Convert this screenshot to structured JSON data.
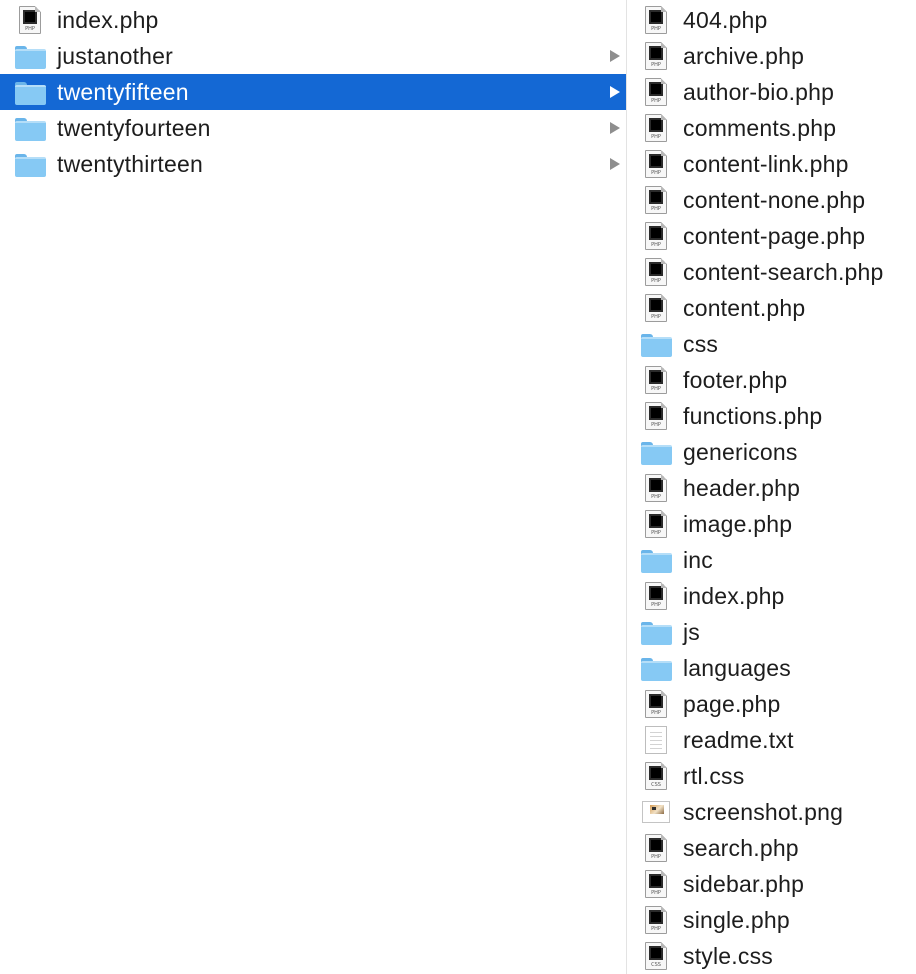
{
  "left_column": {
    "items": [
      {
        "name": "index.php",
        "kind": "php-file",
        "icon_tag": "PHP",
        "has_arrow": false,
        "selected": false
      },
      {
        "name": "justanother",
        "kind": "folder",
        "has_arrow": true,
        "selected": false
      },
      {
        "name": "twentyfifteen",
        "kind": "folder",
        "has_arrow": true,
        "selected": true
      },
      {
        "name": "twentyfourteen",
        "kind": "folder",
        "has_arrow": true,
        "selected": false
      },
      {
        "name": "twentythirteen",
        "kind": "folder",
        "has_arrow": true,
        "selected": false
      }
    ]
  },
  "right_column": {
    "items": [
      {
        "name": "404.php",
        "kind": "php-file",
        "icon_tag": "PHP"
      },
      {
        "name": "archive.php",
        "kind": "php-file",
        "icon_tag": "PHP"
      },
      {
        "name": "author-bio.php",
        "kind": "php-file",
        "icon_tag": "PHP"
      },
      {
        "name": "comments.php",
        "kind": "php-file",
        "icon_tag": "PHP"
      },
      {
        "name": "content-link.php",
        "kind": "php-file",
        "icon_tag": "PHP"
      },
      {
        "name": "content-none.php",
        "kind": "php-file",
        "icon_tag": "PHP"
      },
      {
        "name": "content-page.php",
        "kind": "php-file",
        "icon_tag": "PHP"
      },
      {
        "name": "content-search.php",
        "kind": "php-file",
        "icon_tag": "PHP"
      },
      {
        "name": "content.php",
        "kind": "php-file",
        "icon_tag": "PHP"
      },
      {
        "name": "css",
        "kind": "folder"
      },
      {
        "name": "footer.php",
        "kind": "php-file",
        "icon_tag": "PHP"
      },
      {
        "name": "functions.php",
        "kind": "php-file",
        "icon_tag": "PHP"
      },
      {
        "name": "genericons",
        "kind": "folder"
      },
      {
        "name": "header.php",
        "kind": "php-file",
        "icon_tag": "PHP"
      },
      {
        "name": "image.php",
        "kind": "php-file",
        "icon_tag": "PHP"
      },
      {
        "name": "inc",
        "kind": "folder"
      },
      {
        "name": "index.php",
        "kind": "php-file",
        "icon_tag": "PHP"
      },
      {
        "name": "js",
        "kind": "folder"
      },
      {
        "name": "languages",
        "kind": "folder"
      },
      {
        "name": "page.php",
        "kind": "php-file",
        "icon_tag": "PHP"
      },
      {
        "name": "readme.txt",
        "kind": "text-file"
      },
      {
        "name": "rtl.css",
        "kind": "css-file",
        "icon_tag": "CSS"
      },
      {
        "name": "screenshot.png",
        "kind": "image-file"
      },
      {
        "name": "search.php",
        "kind": "php-file",
        "icon_tag": "PHP"
      },
      {
        "name": "sidebar.php",
        "kind": "php-file",
        "icon_tag": "PHP"
      },
      {
        "name": "single.php",
        "kind": "php-file",
        "icon_tag": "PHP"
      },
      {
        "name": "style.css",
        "kind": "css-file",
        "icon_tag": "CSS"
      }
    ]
  },
  "colors": {
    "selection": "#1468d4",
    "folder": "#86c9f4",
    "arrow": "#8e8e8e",
    "text": "#1d1d1d"
  }
}
